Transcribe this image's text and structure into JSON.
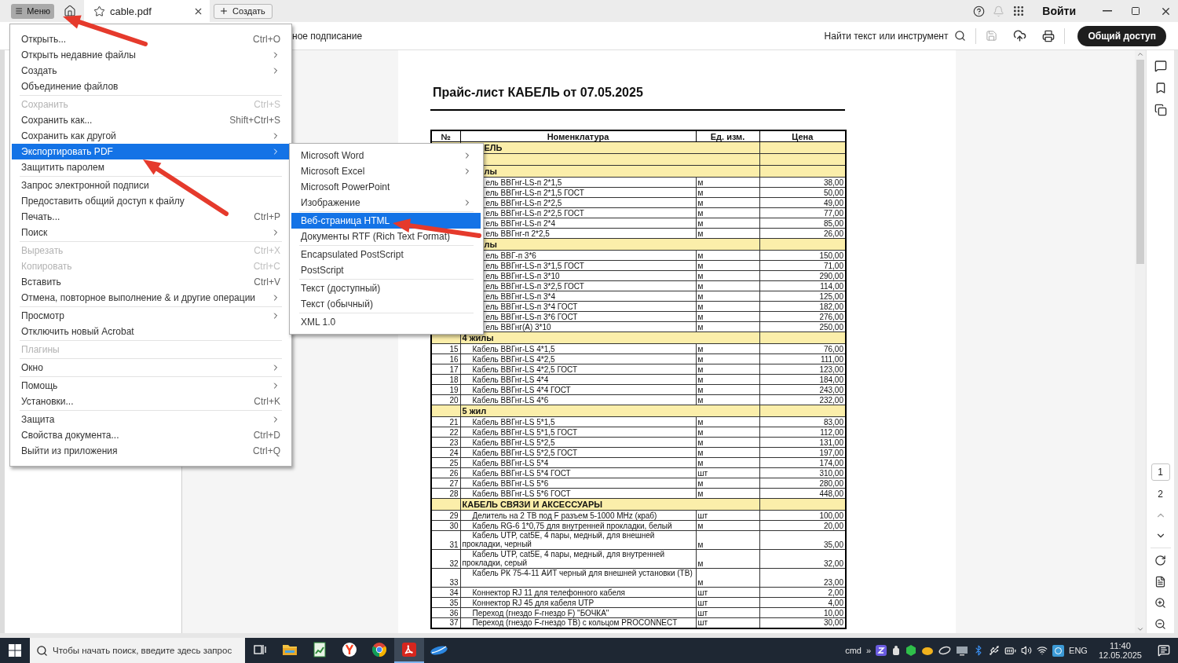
{
  "top_bar": {
    "menu_button": "Меню",
    "tab": {
      "title": "cable.pdf"
    },
    "new_button": "Создать",
    "sign_in": "Войти"
  },
  "toolbar": {
    "tool_label": "ное подписание",
    "search_label": "Найти текст или инструмент",
    "share_button": "Общий доступ"
  },
  "document": {
    "title": "Прайс-лист КАБЕЛЬ от 07.05.2025",
    "table": {
      "columns": [
        "№",
        "Номенклатура",
        "Ед. изм.",
        "Цена"
      ],
      "rows": [
        {
          "kind": "section-cut",
          "title": "ЕЛЬ"
        },
        {
          "kind": "blank"
        },
        {
          "kind": "section-cut",
          "title": "лы"
        },
        {
          "kind": "item-cut",
          "name": "ель ВВГнг-LS-п 2*1,5",
          "unit": "м",
          "price": "38,00"
        },
        {
          "kind": "item-cut",
          "name": "ель ВВГнг-LS-п 2*1,5 ГОСТ",
          "unit": "м",
          "price": "50,00"
        },
        {
          "kind": "item-cut",
          "name": "ель ВВГнг-LS-п 2*2,5",
          "unit": "м",
          "price": "49,00"
        },
        {
          "kind": "item-cut",
          "name": "ель ВВГнг-LS-п 2*2,5 ГОСТ",
          "unit": "м",
          "price": "77,00"
        },
        {
          "kind": "item-cut",
          "name": "ель ВВГнг-LS-п 2*4",
          "unit": "м",
          "price": "85,00"
        },
        {
          "kind": "item-cut",
          "name": "ель ВВГнг-п 2*2,5",
          "unit": "м",
          "price": "26,00"
        },
        {
          "kind": "section-cut",
          "title": "лы"
        },
        {
          "kind": "item-cut",
          "name": "ель ВВГ-п 3*6",
          "unit": "м",
          "price": "150,00"
        },
        {
          "kind": "item-cut",
          "name": "ель ВВГнг-LS-п 3*1,5 ГОСТ",
          "unit": "м",
          "price": "71,00"
        },
        {
          "kind": "item-cut",
          "name": "ель ВВГнг-LS-п 3*10",
          "unit": "м",
          "price": "290,00"
        },
        {
          "kind": "item-cut",
          "name": "ель ВВГнг-LS-п 3*2,5 ГОСТ",
          "unit": "м",
          "price": "114,00"
        },
        {
          "kind": "item-cut",
          "name": "ель ВВГнг-LS-п 3*4",
          "unit": "м",
          "price": "125,00"
        },
        {
          "kind": "item-cut",
          "name": "ель ВВГнг-LS-п 3*4 ГОСТ",
          "unit": "м",
          "price": "182,00"
        },
        {
          "kind": "item-cut",
          "name": "ель ВВГнг-LS-п 3*6 ГОСТ",
          "unit": "м",
          "price": "276,00"
        },
        {
          "kind": "item-cut",
          "name": "ель ВВГнг(А) 3*10",
          "unit": "м",
          "price": "250,00"
        },
        {
          "kind": "section",
          "title": "4 жилы"
        },
        {
          "kind": "item",
          "no": "15",
          "name": "Кабель ВВГнг-LS 4*1,5",
          "unit": "м",
          "price": "76,00"
        },
        {
          "kind": "item",
          "no": "16",
          "name": "Кабель ВВГнг-LS 4*2,5",
          "unit": "м",
          "price": "111,00"
        },
        {
          "kind": "item",
          "no": "17",
          "name": "Кабель ВВГнг-LS 4*2,5 ГОСТ",
          "unit": "м",
          "price": "123,00"
        },
        {
          "kind": "item",
          "no": "18",
          "name": "Кабель ВВГнг-LS 4*4",
          "unit": "м",
          "price": "184,00"
        },
        {
          "kind": "item",
          "no": "19",
          "name": "Кабель ВВГнг-LS 4*4 ГОСТ",
          "unit": "м",
          "price": "243,00"
        },
        {
          "kind": "item",
          "no": "20",
          "name": "Кабель ВВГнг-LS 4*6",
          "unit": "м",
          "price": "232,00"
        },
        {
          "kind": "section",
          "title": "5 жил"
        },
        {
          "kind": "item",
          "no": "21",
          "name": "Кабель ВВГнг-LS 5*1,5",
          "unit": "м",
          "price": "83,00"
        },
        {
          "kind": "item",
          "no": "22",
          "name": "Кабель ВВГнг-LS 5*1,5 ГОСТ",
          "unit": "м",
          "price": "112,00"
        },
        {
          "kind": "item",
          "no": "23",
          "name": "Кабель ВВГнг-LS 5*2,5",
          "unit": "м",
          "price": "131,00"
        },
        {
          "kind": "item",
          "no": "24",
          "name": "Кабель ВВГнг-LS 5*2,5 ГОСТ",
          "unit": "м",
          "price": "197,00"
        },
        {
          "kind": "item",
          "no": "25",
          "name": "Кабель ВВГнг-LS 5*4",
          "unit": "м",
          "price": "174,00"
        },
        {
          "kind": "item",
          "no": "26",
          "name": "Кабель ВВГнг-LS 5*4 ГОСТ",
          "unit": "шт",
          "price": "310,00"
        },
        {
          "kind": "item",
          "no": "27",
          "name": "Кабель ВВГнг-LS 5*6",
          "unit": "м",
          "price": "280,00"
        },
        {
          "kind": "item",
          "no": "28",
          "name": "Кабель ВВГнг-LS 5*6 ГОСТ",
          "unit": "м",
          "price": "448,00"
        },
        {
          "kind": "section",
          "title": "КАБЕЛЬ СВЯЗИ И АКСЕССУАРЫ"
        },
        {
          "kind": "item",
          "no": "29",
          "name": "Делитель на 2 ТВ под F разъем 5-1000 MHz (краб)",
          "unit": "шт",
          "price": "100,00"
        },
        {
          "kind": "item",
          "no": "30",
          "name": "Кабель RG-6 1*0,75 для внутренней прокладки, белый",
          "unit": "м",
          "price": "20,00"
        },
        {
          "kind": "item-tall",
          "no": "31",
          "name": "Кабель UTP, cat5E, 4 пары, медный, для внешней прокладки, черный",
          "unit": "м",
          "price": "35,00"
        },
        {
          "kind": "item-tall",
          "no": "32",
          "name": "Кабель UTP, cat5E, 4 пары, медный, для внутренней прокладки, серый",
          "unit": "м",
          "price": "32,00"
        },
        {
          "kind": "item-tall",
          "no": "33",
          "name": "Кабель РК 75-4-11 АИТ черный для внешней установки (ТВ)",
          "unit": "м",
          "price": "23,00"
        },
        {
          "kind": "item",
          "no": "34",
          "name": "Коннектор RJ 11 для телефонного кабеля",
          "unit": "шт",
          "price": "2,00"
        },
        {
          "kind": "item",
          "no": "35",
          "name": "Коннектор RJ 45 для кабеля UTP",
          "unit": "шт",
          "price": "4,00"
        },
        {
          "kind": "item",
          "no": "36",
          "name": "Переход (гнездо F-гнездо F) \"БОЧКА\"",
          "unit": "шт",
          "price": "10,00"
        },
        {
          "kind": "item",
          "no": "37",
          "name": "Переход (гнездо F-гнездо ТВ) с кольцом PROCONNECT",
          "unit": "шт",
          "price": "30,00"
        }
      ]
    }
  },
  "page_nav": [
    {
      "label": "1",
      "selected": true
    },
    {
      "label": "2",
      "selected": false
    }
  ],
  "menu": {
    "items": [
      {
        "kind": "item",
        "label": "Открыть...",
        "shortcut": "Ctrl+O",
        "submenu": false,
        "disabled": false,
        "selected": false
      },
      {
        "kind": "item",
        "label": "Открыть недавние файлы",
        "submenu": true,
        "disabled": false,
        "selected": false
      },
      {
        "kind": "item",
        "label": "Создать",
        "submenu": true,
        "disabled": false,
        "selected": false
      },
      {
        "kind": "item",
        "label": "Объединение файлов",
        "submenu": false,
        "disabled": false,
        "selected": false
      },
      {
        "kind": "separator"
      },
      {
        "kind": "item",
        "label": "Сохранить",
        "shortcut": "Ctrl+S",
        "submenu": false,
        "disabled": true,
        "selected": false
      },
      {
        "kind": "item",
        "label": "Сохранить как...",
        "shortcut": "Shift+Ctrl+S",
        "submenu": false,
        "disabled": false,
        "selected": false
      },
      {
        "kind": "item",
        "label": "Сохранить как другой",
        "submenu": true,
        "disabled": false,
        "selected": false
      },
      {
        "kind": "item",
        "label": "Экспортировать PDF",
        "submenu": true,
        "disabled": false,
        "selected": true
      },
      {
        "kind": "item",
        "label": "Защитить паролем",
        "submenu": false,
        "disabled": false,
        "selected": false
      },
      {
        "kind": "separator"
      },
      {
        "kind": "item",
        "label": "Запрос электронной подписи",
        "submenu": false,
        "disabled": false,
        "selected": false
      },
      {
        "kind": "item",
        "label": "Предоставить общий доступ к файлу",
        "submenu": false,
        "disabled": false,
        "selected": false
      },
      {
        "kind": "item",
        "label": "Печать...",
        "shortcut": "Ctrl+P",
        "submenu": false,
        "disabled": false,
        "selected": false
      },
      {
        "kind": "item",
        "label": "Поиск",
        "submenu": true,
        "disabled": false,
        "selected": false
      },
      {
        "kind": "separator"
      },
      {
        "kind": "item",
        "label": "Вырезать",
        "shortcut": "Ctrl+X",
        "submenu": false,
        "disabled": true,
        "selected": false
      },
      {
        "kind": "item",
        "label": "Копировать",
        "shortcut": "Ctrl+C",
        "submenu": false,
        "disabled": true,
        "selected": false
      },
      {
        "kind": "item",
        "label": "Вставить",
        "shortcut": "Ctrl+V",
        "submenu": false,
        "disabled": false,
        "selected": false
      },
      {
        "kind": "item",
        "label": "Отмена, повторное выполнение & и другие операции",
        "submenu": true,
        "disabled": false,
        "selected": false
      },
      {
        "kind": "separator"
      },
      {
        "kind": "item",
        "label": "Просмотр",
        "submenu": true,
        "disabled": false,
        "selected": false
      },
      {
        "kind": "item",
        "label": "Отключить новый Acrobat",
        "submenu": false,
        "disabled": false,
        "selected": false
      },
      {
        "kind": "separator"
      },
      {
        "kind": "item",
        "label": "Плагины",
        "submenu": false,
        "disabled": true,
        "selected": false
      },
      {
        "kind": "separator"
      },
      {
        "kind": "item",
        "label": "Окно",
        "submenu": true,
        "disabled": false,
        "selected": false
      },
      {
        "kind": "separator"
      },
      {
        "kind": "item",
        "label": "Помощь",
        "submenu": true,
        "disabled": false,
        "selected": false
      },
      {
        "kind": "item",
        "label": "Установки...",
        "shortcut": "Ctrl+K",
        "submenu": false,
        "disabled": false,
        "selected": false
      },
      {
        "kind": "separator"
      },
      {
        "kind": "item",
        "label": "Защита",
        "submenu": true,
        "disabled": false,
        "selected": false
      },
      {
        "kind": "item",
        "label": "Свойства документа...",
        "shortcut": "Ctrl+D",
        "submenu": false,
        "disabled": false,
        "selected": false
      },
      {
        "kind": "item",
        "label": "Выйти из приложения",
        "shortcut": "Ctrl+Q",
        "submenu": false,
        "disabled": false,
        "selected": false
      }
    ]
  },
  "submenu": {
    "items": [
      {
        "kind": "item",
        "label": "Microsoft Word",
        "submenu": true,
        "selected": false
      },
      {
        "kind": "item",
        "label": "Microsoft Excel",
        "submenu": true,
        "selected": false
      },
      {
        "kind": "item",
        "label": "Microsoft PowerPoint",
        "submenu": false,
        "selected": false
      },
      {
        "kind": "item",
        "label": "Изображение",
        "submenu": true,
        "selected": false
      },
      {
        "kind": "separator"
      },
      {
        "kind": "item",
        "label": "Веб-страница HTML",
        "submenu": false,
        "selected": true
      },
      {
        "kind": "item",
        "label": "Документы RTF (Rich Text Format)",
        "submenu": false,
        "selected": false
      },
      {
        "kind": "separator"
      },
      {
        "kind": "item",
        "label": "Encapsulated PostScript",
        "submenu": false,
        "selected": false
      },
      {
        "kind": "item",
        "label": "PostScript",
        "submenu": false,
        "selected": false
      },
      {
        "kind": "separator"
      },
      {
        "kind": "item",
        "label": "Текст (доступный)",
        "submenu": false,
        "selected": false
      },
      {
        "kind": "item",
        "label": "Текст (обычный)",
        "submenu": false,
        "selected": false
      },
      {
        "kind": "separator"
      },
      {
        "kind": "item",
        "label": "XML 1.0",
        "submenu": false,
        "selected": false
      }
    ]
  },
  "taskbar": {
    "search_placeholder": "Чтобы начать поиск, введите здесь запрос",
    "apps": [
      {
        "kind": "explorer",
        "selected": false
      },
      {
        "kind": "spreadsheet",
        "selected": false
      },
      {
        "kind": "yandex",
        "selected": false
      },
      {
        "kind": "chrome",
        "selected": false
      },
      {
        "kind": "acrobat",
        "selected": true
      },
      {
        "kind": "feather",
        "selected": false
      }
    ],
    "tray_label": "cmd",
    "overflow": "»",
    "language": "ENG",
    "time": "11:40",
    "date": "12.05.2025"
  }
}
